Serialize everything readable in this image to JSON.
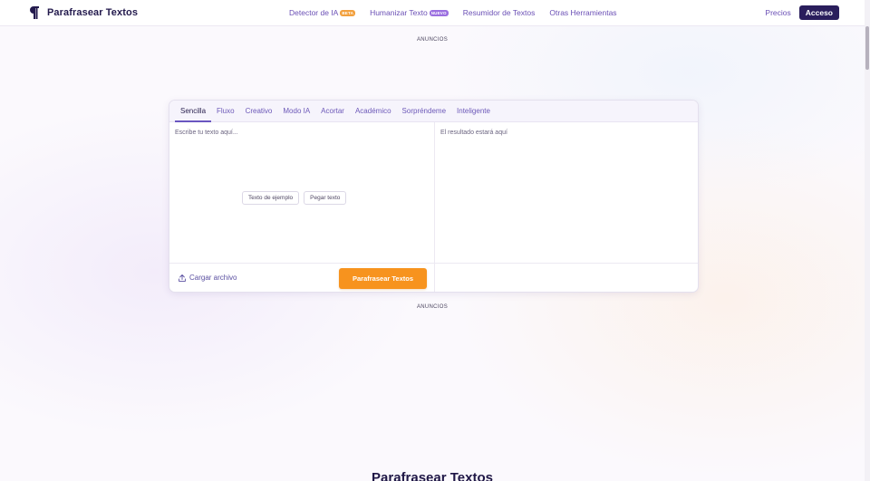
{
  "header": {
    "brand": "Parafrasear Textos",
    "nav": [
      {
        "label": "Detector de IA",
        "badge": "BETA"
      },
      {
        "label": "Humanizar Texto",
        "badge": "NUEVO"
      },
      {
        "label": "Resumidor de Textos"
      },
      {
        "label": "Otras Herramientas"
      }
    ],
    "prices_label": "Precios",
    "login_label": "Acceso"
  },
  "ads": {
    "top": "ANUNCIOS",
    "bottom": "ANUNCIOS"
  },
  "tool": {
    "tabs": [
      "Sencilla",
      "Fluxo",
      "Creativo",
      "Modo IA",
      "Acortar",
      "Académico",
      "Sorpréndeme",
      "Inteligente"
    ],
    "active_tab": "Sencilla",
    "input_placeholder": "Escribe tu texto aquí...",
    "output_placeholder": "El resultado estará aquí",
    "sample_button": "Texto de ejemplo",
    "paste_button": "Pegar texto",
    "upload_label": "Cargar archivo",
    "submit_label": "Parafrasear Textos"
  },
  "section_heading": "Parafrasear Textos",
  "colors": {
    "brand_dark": "#2a1e5c",
    "accent_purple": "#6a4fb5",
    "primary_orange": "#f7931e",
    "badge_beta": "#f2a03d",
    "badge_nuevo": "#9b6fe0"
  },
  "icons": {
    "brand": "pilcrow-icon",
    "upload": "upload-icon"
  }
}
